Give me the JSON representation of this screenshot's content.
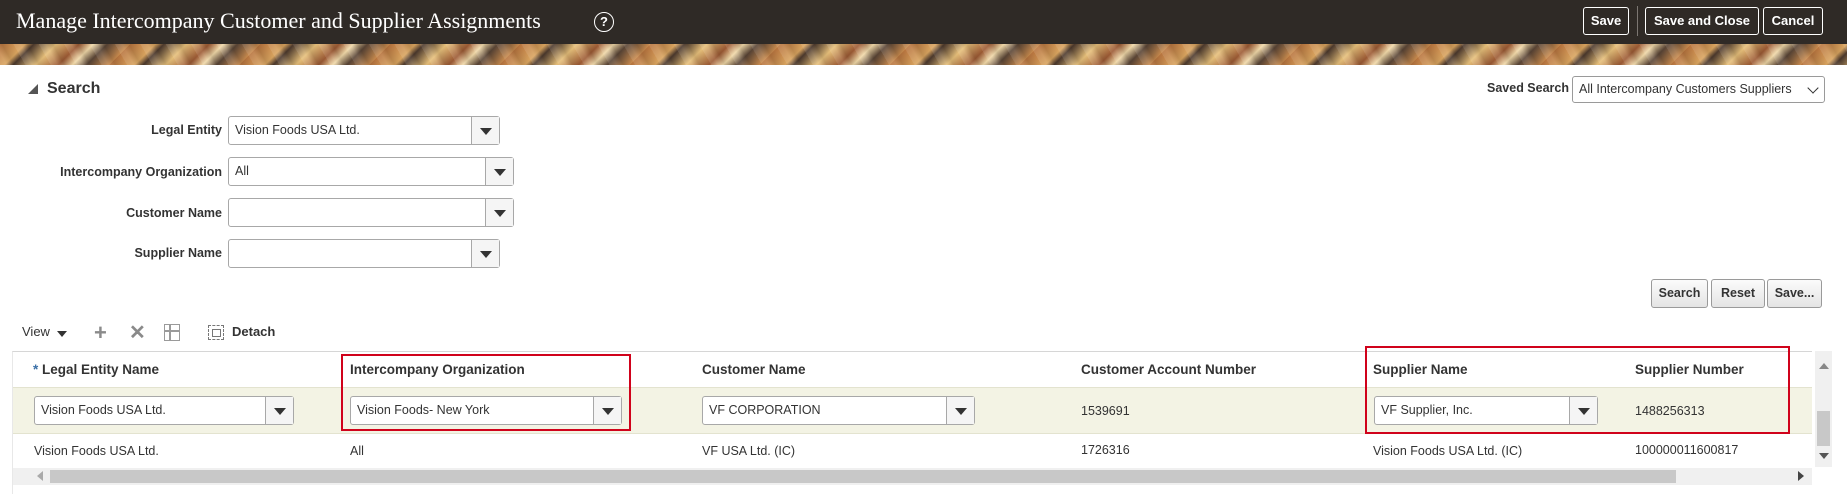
{
  "header": {
    "title": "Manage Intercompany Customer and Supplier Assignments",
    "help_glyph": "?",
    "buttons": {
      "save": "Save",
      "save_and_close": "Save and Close",
      "cancel": "Cancel"
    }
  },
  "search": {
    "title": "Search",
    "saved_search": {
      "label": "Saved Search",
      "value": "All Intercompany Customers Suppliers"
    },
    "fields": {
      "legal_entity": {
        "label": "Legal Entity",
        "value": "Vision Foods USA Ltd."
      },
      "intercompany_organization": {
        "label": "Intercompany Organization",
        "value": "All"
      },
      "customer_name": {
        "label": "Customer Name",
        "value": ""
      },
      "supplier_name": {
        "label": "Supplier Name",
        "value": ""
      }
    },
    "buttons": {
      "search": "Search",
      "reset": "Reset",
      "save": "Save..."
    }
  },
  "toolbar": {
    "view": "View",
    "add_icon": "+",
    "delete_icon": "✕",
    "detach": "Detach"
  },
  "table": {
    "required_marker": "*",
    "columns": {
      "legal_entity_name": "Legal Entity Name",
      "intercompany_organization": "Intercompany Organization",
      "customer_name": "Customer Name",
      "customer_account_number": "Customer Account Number",
      "supplier_name": "Supplier Name",
      "supplier_number": "Supplier Number"
    },
    "rows": [
      {
        "legal_entity_name": "Vision Foods USA Ltd.",
        "intercompany_organization": "Vision Foods- New York",
        "customer_name": "VF CORPORATION",
        "customer_account_number": "1539691",
        "supplier_name": "VF Supplier, Inc.",
        "supplier_number": "1488256313"
      },
      {
        "legal_entity_name": "Vision Foods USA Ltd.",
        "intercompany_organization": "All",
        "customer_name": "VF USA Ltd. (IC)",
        "customer_account_number": "1726316",
        "supplier_name": "Vision Foods USA Ltd. (IC)",
        "supplier_number": "100000011600817"
      }
    ]
  },
  "colors": {
    "header_bg": "#2f2a26",
    "selected_row_bg": "#f3f3e4",
    "highlight_border": "#d0021b",
    "required_marker": "#3a6fa6"
  }
}
